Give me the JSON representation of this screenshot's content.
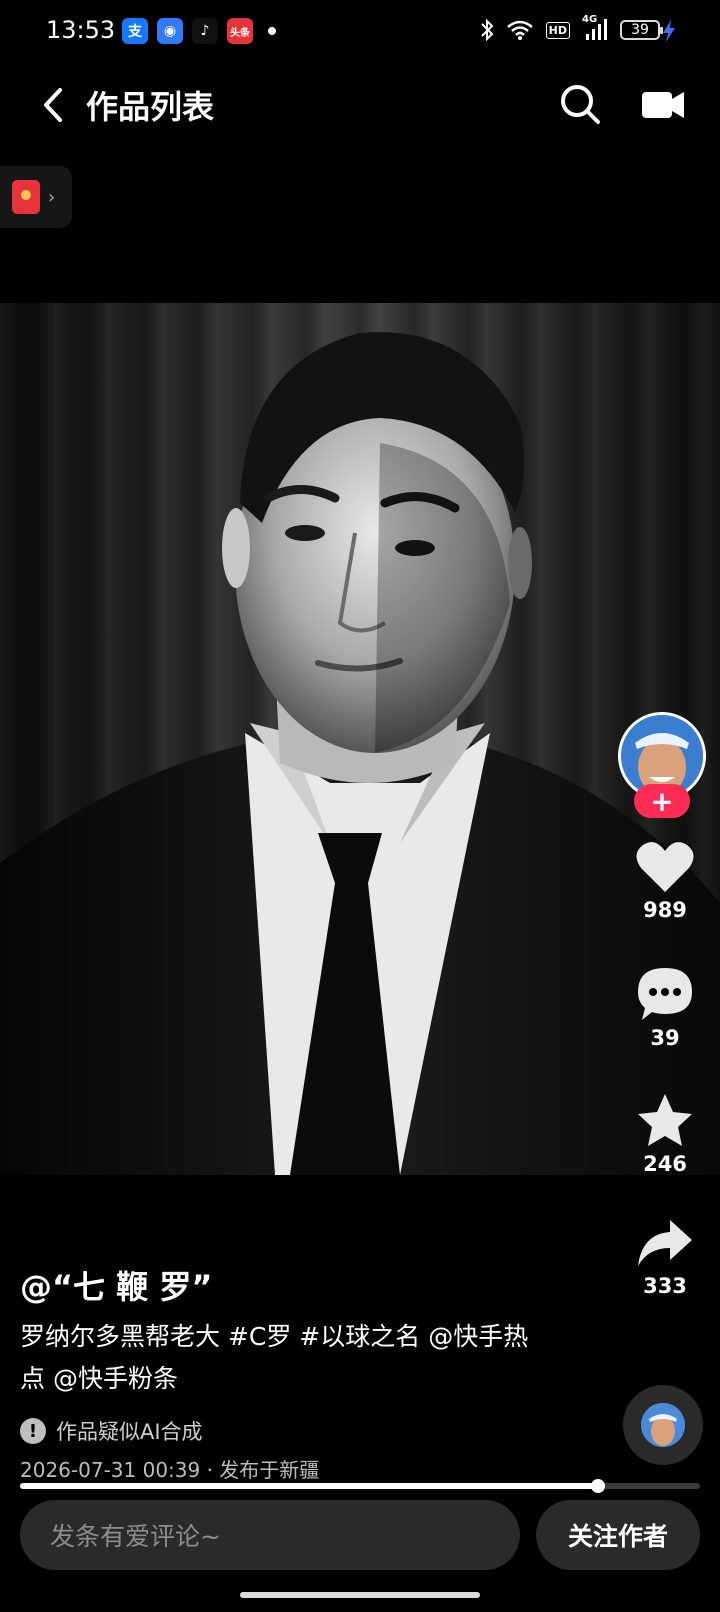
{
  "status_bar": {
    "time": "13:53",
    "notifications": [
      {
        "name": "alipay-icon",
        "glyph": "支",
        "color": "#1677ff"
      },
      {
        "name": "browser-icon",
        "glyph": "◉",
        "color": "#2f7cf6"
      },
      {
        "name": "douyin-icon",
        "glyph": "♪",
        "color": "#111111"
      },
      {
        "name": "toutiao-icon",
        "glyph": "头条",
        "color": "#e8333b"
      }
    ],
    "network": "4G",
    "hd_label": "HD",
    "battery": "39"
  },
  "header": {
    "title": "作品列表",
    "back_icon": "chevron-left-icon",
    "search_icon": "search-icon",
    "camera_icon": "camera-icon"
  },
  "red_packet": {
    "icon": "red-envelope-icon",
    "chevron": "›"
  },
  "side_rail": {
    "follow_plus": "+",
    "likes": "989",
    "comments": "39",
    "favorites": "246",
    "shares": "333"
  },
  "post": {
    "author": "@“七 鞭 罗”",
    "caption": "罗纳尔多黑帮老大 #C罗 #以球之名 @快手热点 @快手粉条",
    "ai_badge": "!",
    "ai_note": "作品疑似AI合成",
    "publish_info": "2026-07-31 00:39 · 发布于新疆"
  },
  "playback": {
    "progress": 0.85
  },
  "bottom_bar": {
    "comment_placeholder": "发条有爱评论~",
    "follow_button": "关注作者"
  },
  "colors": {
    "accent": "#fe2c55",
    "background": "#000000"
  }
}
